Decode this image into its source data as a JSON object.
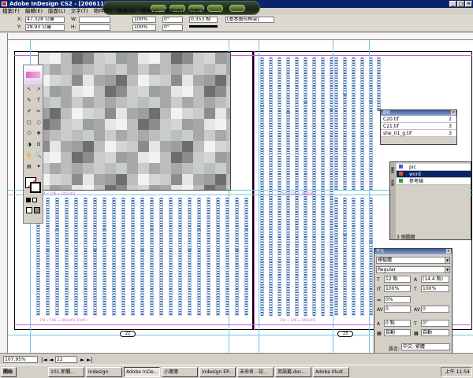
{
  "window": {
    "title": "Adobe InDesign CS2 - [20061119.indd @ 107%]"
  },
  "menu": [
    "檔案(F)",
    "編輯(E)",
    "版面(L)",
    "文字(T)",
    "物件(O)",
    "表格(A)",
    "檢視(V)",
    "視窗(W)",
    "說明(H)"
  ],
  "control": {
    "x_label": "X:",
    "y_label": "Y:",
    "w_label": "W:",
    "h_label": "H:",
    "x_value": "47.328 公釐",
    "y_value": "28.93 公釐",
    "w_value": "",
    "h_value": "",
    "scale_x": "100%",
    "scale_y": "100%",
    "angle": "0°",
    "shear": "0°",
    "stroke_weight": "0.353 點",
    "style_dropdown": "[基本圖形框架]"
  },
  "canvas": {
    "page_left_number": "22",
    "page_right_number": "23",
    "slug_top_left": "254 × 196 = 1001(45)",
    "slug_top_right": "254 × 196 = 1001(45)",
    "slug_bottom_left": "254 × 196 = 1001(45) 50(45)",
    "slug_bottom_right": "254 × 196 = 1001(45)"
  },
  "links_panel": {
    "title": "連結",
    "items": [
      {
        "name": "C20.tif",
        "page": "2"
      },
      {
        "name": "C21.tif",
        "page": "3"
      },
      {
        "name": "she_01_g.tif",
        "page": "3"
      }
    ]
  },
  "layers_panel": {
    "tabs": [
      "圖層",
      "頁面"
    ],
    "items": [
      {
        "name": "pic"
      },
      {
        "name": "word",
        "selected": true
      },
      {
        "name": "參考線"
      }
    ],
    "footer": "3 個圖層"
  },
  "character_panel": {
    "title": "字元",
    "font_family": "標楷體",
    "font_style": "Regular",
    "size": "12 點",
    "leading": "(14.4 點)",
    "vertical_scale": "100%",
    "horizontal_scale": "100%",
    "tsume": "0%",
    "kerning": "0",
    "tracking": "0",
    "baseline": "0 點",
    "rotation": "0°",
    "grid_alignment": "自動",
    "grid_alignment2": "自動",
    "language_label": "語言:",
    "language": "中文: 繁體"
  },
  "statusbar": {
    "zoom": "107.95%",
    "page": "22"
  },
  "taskbar": {
    "start": "開始",
    "items": [
      "101.新聞...",
      "indesign",
      "Adobe InDe...",
      "小蓮蓮",
      "indesign EP...",
      "未命名 - 記...",
      "英語篇.doc...",
      "Adobe Illust..."
    ],
    "active_index": 2,
    "clock": "上午 11:54"
  },
  "colors": {
    "title_bar": "#0a246a",
    "guide_cyan": "#6ec8e0",
    "margin_magenta": "#d05ad0",
    "text_frame_blue": "#4a6a9a"
  }
}
